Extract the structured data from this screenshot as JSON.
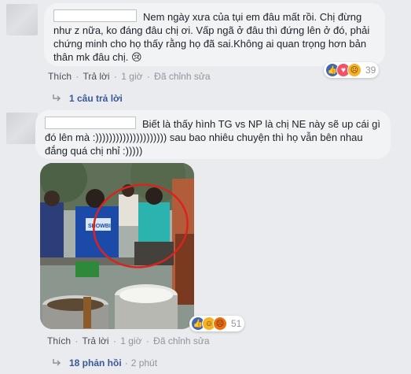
{
  "comments": [
    {
      "text": "Nem ngày xưa của tụi em đâu mất rồi. Chị đừng như z nữa, ko đáng đâu chị ơi. Vấp ngã ở đâu thì đứng lên ở đó, phải chứng minh cho họ thấy rằng họ đã sai.Không ai quan trọng hơn bản thân mk đâu chị. 😢",
      "actions": {
        "like": "Thích",
        "reply": "Trả lời",
        "time": "1 giờ",
        "edited": "Đã chỉnh sửa"
      },
      "reactions": {
        "icons": [
          "like-icon",
          "love-icon",
          "sad-icon"
        ],
        "count": "39"
      },
      "replies": {
        "label": "1 câu trả lời",
        "time": ""
      }
    },
    {
      "text": "Biết là thấy hình TG vs NP là chị NE này sẽ up cái gì đó lên mà :))))))))))))))))))))) sau bao nhiêu chuyện thì họ vẫn bên nhau đắng quá chị nhỉ :)))))",
      "actions": {
        "like": "Thích",
        "reply": "Trả lời",
        "time": "1 giờ",
        "edited": "Đã chỉnh sửa"
      },
      "reactions": {
        "icons": [
          "like-icon",
          "haha-icon",
          "angry-icon"
        ],
        "count": "51"
      },
      "replies": {
        "label": "18 phản hồi",
        "time": "2 phút"
      },
      "photo": {
        "watermark": "SHOWBIZ"
      }
    }
  ],
  "colors": {
    "link": "#385898",
    "muted": "#90949c",
    "bubble": "#f2f3f5",
    "like": "#4267b2",
    "love": "#f25268",
    "sad": "#f7b125",
    "angry": "#e9710f"
  }
}
